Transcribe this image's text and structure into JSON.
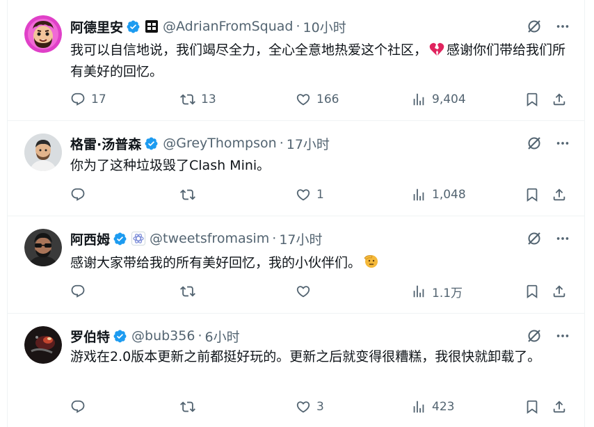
{
  "tweets": [
    {
      "name": "阿德里安",
      "handle": "@AdrianFromSquad",
      "time": "10小时",
      "avatar": "cartoon-avatar",
      "text": "我可以自信地说，我们竭尽全力，全心全意地热爱这个社区，",
      "text_after_emoji": "感谢你们带给我们所有美好的回忆。",
      "emoji": "broken-heart-emoji",
      "replies": "17",
      "retweets": "13",
      "likes": "166",
      "views": "9,404"
    },
    {
      "name": "格雷·汤普森",
      "handle": "@GreyThompson",
      "time": "17小时",
      "avatar": "photo-avatar",
      "text": "你为了这种垃圾毁了Clash Mini。",
      "replies": "",
      "retweets": "",
      "likes": "1",
      "views": "1,048"
    },
    {
      "name": "阿西姆",
      "handle": "@tweetsfromasim",
      "time": "17小时",
      "avatar": "photo-avatar",
      "text": "感谢大家带给我的所有美好回忆，我的小伙伴们。",
      "emoji": "saluting-face-emoji",
      "replies": "",
      "retweets": "",
      "likes": "",
      "views": "1.1万"
    },
    {
      "name": "罗伯特",
      "handle": "@bub356",
      "time": "6小时",
      "avatar": "photo-avatar",
      "text": "游戏在2.0版本更新之前都挺好玩的。更新之后就变得很糟糕，我很快就卸载了。",
      "replies": "",
      "retweets": "",
      "likes": "3",
      "views": "423"
    }
  ],
  "colors": {
    "text": "#0f1419",
    "secondary": "#536471",
    "verified": "#1d9bf0",
    "border": "#eff3f4"
  }
}
